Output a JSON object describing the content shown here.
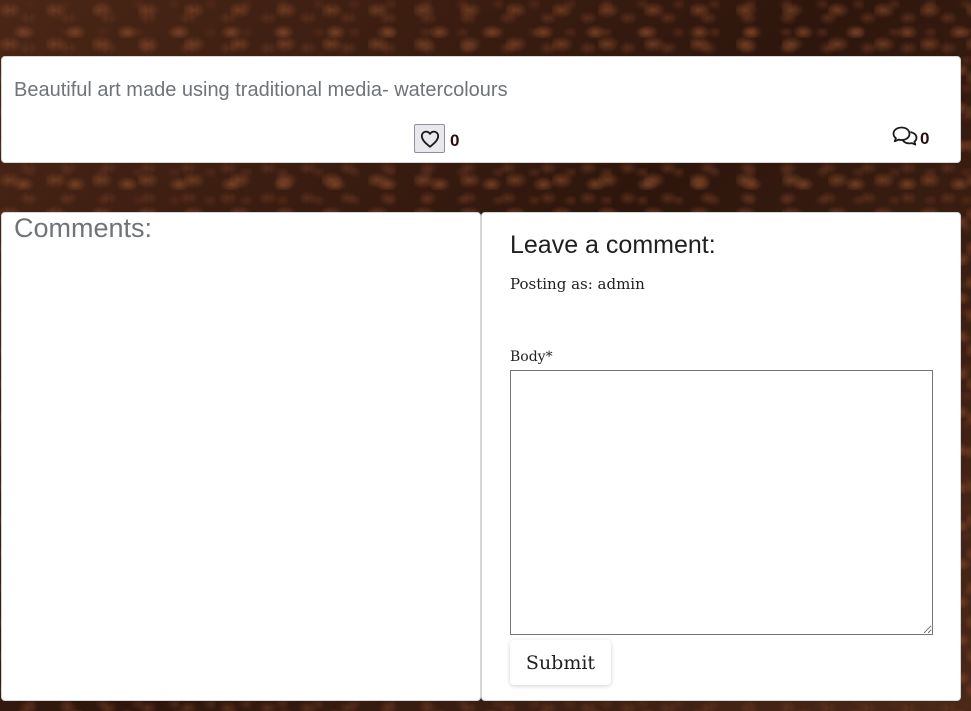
{
  "post": {
    "excerpt": "Beautiful art made using traditional media- watercolours",
    "like_count": "0",
    "comment_count": "0",
    "like_icon": "heart-outline-icon",
    "comments_icon": "speech-bubbles-icon"
  },
  "comments": {
    "heading": "Comments:"
  },
  "comment_form": {
    "heading": "Leave a comment:",
    "posting_as": "Posting as: admin",
    "body_label": "Body*",
    "body_value": "",
    "submit_label": "Submit"
  },
  "colors": {
    "background": "#3a1e12",
    "card": "#ffffff",
    "muted_text": "#6f7479",
    "count_text": "#2b0f0f"
  }
}
